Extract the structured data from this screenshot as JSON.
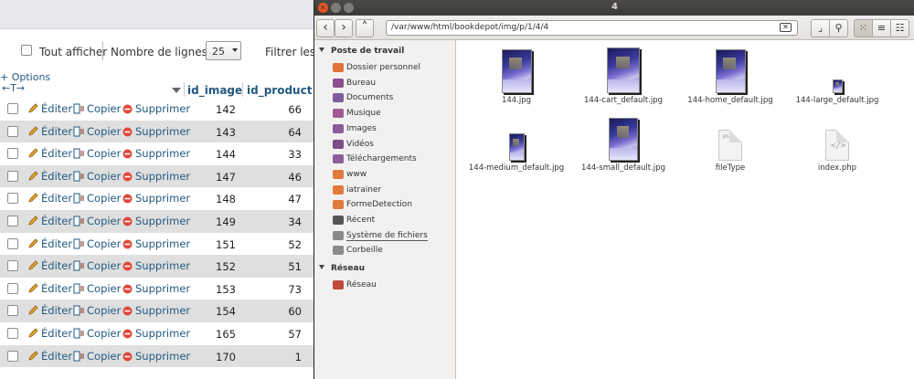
{
  "pma": {
    "show_all": "Tout afficher",
    "rows_label": "Nombre de lignes :",
    "rows_value": "25",
    "filter_label": "Filtrer les",
    "options_link": "+ Options",
    "sort_arrows": "←T→",
    "columns": [
      "id_image",
      "id_product"
    ],
    "actions": {
      "edit": "Éditer",
      "copy": "Copier",
      "delete": "Supprimer"
    },
    "rows": [
      {
        "id_image": "142",
        "id_product": "66"
      },
      {
        "id_image": "143",
        "id_product": "64"
      },
      {
        "id_image": "144",
        "id_product": "33"
      },
      {
        "id_image": "147",
        "id_product": "46"
      },
      {
        "id_image": "148",
        "id_product": "47"
      },
      {
        "id_image": "149",
        "id_product": "34"
      },
      {
        "id_image": "151",
        "id_product": "52"
      },
      {
        "id_image": "152",
        "id_product": "51"
      },
      {
        "id_image": "153",
        "id_product": "73"
      },
      {
        "id_image": "154",
        "id_product": "60"
      },
      {
        "id_image": "165",
        "id_product": "57"
      },
      {
        "id_image": "170",
        "id_product": "1"
      }
    ]
  },
  "nautilus": {
    "window_title": "4",
    "path": "/var/www/html/bookdepot/img/p/1/4/4",
    "sidebar": {
      "section_computer": "Poste de travail",
      "section_network": "Réseau",
      "computer_items": [
        {
          "label": "Dossier personnel",
          "icon": "home-folder-icon",
          "color": "#e0723a"
        },
        {
          "label": "Bureau",
          "icon": "desktop-folder-icon",
          "color": "#8a4f8e"
        },
        {
          "label": "Documents",
          "icon": "documents-folder-icon",
          "color": "#7e5c9e"
        },
        {
          "label": "Musique",
          "icon": "music-folder-icon",
          "color": "#a35a94"
        },
        {
          "label": "Images",
          "icon": "pictures-folder-icon",
          "color": "#8b5a9a"
        },
        {
          "label": "Vidéos",
          "icon": "videos-folder-icon",
          "color": "#7c4d86"
        },
        {
          "label": "Téléchargements",
          "icon": "downloads-folder-icon",
          "color": "#8e5f9a"
        },
        {
          "label": "www",
          "icon": "folder-icon",
          "color": "#e07b3c"
        },
        {
          "label": "iatrainer",
          "icon": "folder-icon",
          "color": "#e07b3c"
        },
        {
          "label": "FormeDetection",
          "icon": "folder-icon",
          "color": "#e07b3c"
        },
        {
          "label": "Récent",
          "icon": "recent-icon",
          "color": "#555555"
        },
        {
          "label": "Système de fichiers",
          "icon": "filesystem-icon",
          "color": "#8a8a8a"
        },
        {
          "label": "Corbeille",
          "icon": "trash-icon",
          "color": "#8a8a8a"
        }
      ],
      "network_items": [
        {
          "label": "Réseau",
          "icon": "network-icon",
          "color": "#c04a3a"
        }
      ]
    },
    "files": [
      {
        "name": "144.jpg",
        "kind": "image"
      },
      {
        "name": "144-cart_default.jpg",
        "kind": "image"
      },
      {
        "name": "144-home_default.jpg",
        "kind": "image"
      },
      {
        "name": "144-large_default.jpg",
        "kind": "image"
      },
      {
        "name": "144-medium_default.jpg",
        "kind": "image"
      },
      {
        "name": "144-small_default.jpg",
        "kind": "image"
      },
      {
        "name": "fileType",
        "kind": "text"
      },
      {
        "name": "index.php",
        "kind": "code"
      }
    ]
  }
}
